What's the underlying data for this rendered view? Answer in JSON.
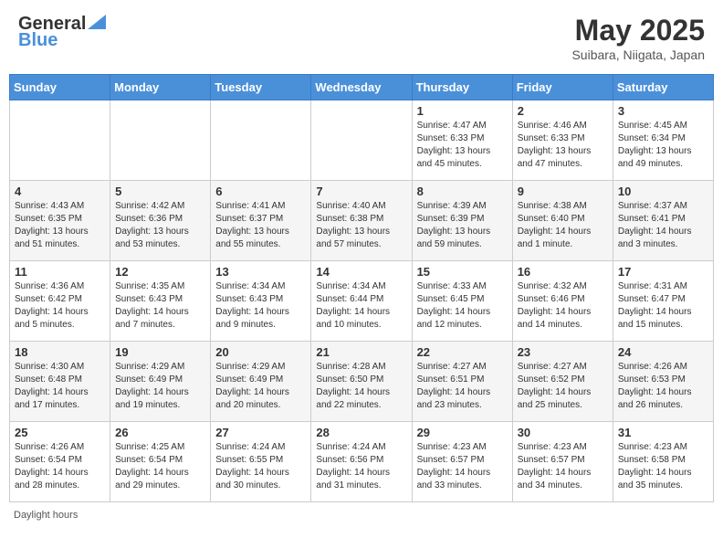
{
  "header": {
    "logo_line1": "General",
    "logo_line2": "Blue",
    "title": "May 2025",
    "subtitle": "Suibara, Niigata, Japan"
  },
  "days_of_week": [
    "Sunday",
    "Monday",
    "Tuesday",
    "Wednesday",
    "Thursday",
    "Friday",
    "Saturday"
  ],
  "footer": "Daylight hours",
  "weeks": [
    [
      {
        "day": "",
        "info": ""
      },
      {
        "day": "",
        "info": ""
      },
      {
        "day": "",
        "info": ""
      },
      {
        "day": "",
        "info": ""
      },
      {
        "day": "1",
        "info": "Sunrise: 4:47 AM\nSunset: 6:33 PM\nDaylight: 13 hours\nand 45 minutes."
      },
      {
        "day": "2",
        "info": "Sunrise: 4:46 AM\nSunset: 6:33 PM\nDaylight: 13 hours\nand 47 minutes."
      },
      {
        "day": "3",
        "info": "Sunrise: 4:45 AM\nSunset: 6:34 PM\nDaylight: 13 hours\nand 49 minutes."
      }
    ],
    [
      {
        "day": "4",
        "info": "Sunrise: 4:43 AM\nSunset: 6:35 PM\nDaylight: 13 hours\nand 51 minutes."
      },
      {
        "day": "5",
        "info": "Sunrise: 4:42 AM\nSunset: 6:36 PM\nDaylight: 13 hours\nand 53 minutes."
      },
      {
        "day": "6",
        "info": "Sunrise: 4:41 AM\nSunset: 6:37 PM\nDaylight: 13 hours\nand 55 minutes."
      },
      {
        "day": "7",
        "info": "Sunrise: 4:40 AM\nSunset: 6:38 PM\nDaylight: 13 hours\nand 57 minutes."
      },
      {
        "day": "8",
        "info": "Sunrise: 4:39 AM\nSunset: 6:39 PM\nDaylight: 13 hours\nand 59 minutes."
      },
      {
        "day": "9",
        "info": "Sunrise: 4:38 AM\nSunset: 6:40 PM\nDaylight: 14 hours\nand 1 minute."
      },
      {
        "day": "10",
        "info": "Sunrise: 4:37 AM\nSunset: 6:41 PM\nDaylight: 14 hours\nand 3 minutes."
      }
    ],
    [
      {
        "day": "11",
        "info": "Sunrise: 4:36 AM\nSunset: 6:42 PM\nDaylight: 14 hours\nand 5 minutes."
      },
      {
        "day": "12",
        "info": "Sunrise: 4:35 AM\nSunset: 6:43 PM\nDaylight: 14 hours\nand 7 minutes."
      },
      {
        "day": "13",
        "info": "Sunrise: 4:34 AM\nSunset: 6:43 PM\nDaylight: 14 hours\nand 9 minutes."
      },
      {
        "day": "14",
        "info": "Sunrise: 4:34 AM\nSunset: 6:44 PM\nDaylight: 14 hours\nand 10 minutes."
      },
      {
        "day": "15",
        "info": "Sunrise: 4:33 AM\nSunset: 6:45 PM\nDaylight: 14 hours\nand 12 minutes."
      },
      {
        "day": "16",
        "info": "Sunrise: 4:32 AM\nSunset: 6:46 PM\nDaylight: 14 hours\nand 14 minutes."
      },
      {
        "day": "17",
        "info": "Sunrise: 4:31 AM\nSunset: 6:47 PM\nDaylight: 14 hours\nand 15 minutes."
      }
    ],
    [
      {
        "day": "18",
        "info": "Sunrise: 4:30 AM\nSunset: 6:48 PM\nDaylight: 14 hours\nand 17 minutes."
      },
      {
        "day": "19",
        "info": "Sunrise: 4:29 AM\nSunset: 6:49 PM\nDaylight: 14 hours\nand 19 minutes."
      },
      {
        "day": "20",
        "info": "Sunrise: 4:29 AM\nSunset: 6:49 PM\nDaylight: 14 hours\nand 20 minutes."
      },
      {
        "day": "21",
        "info": "Sunrise: 4:28 AM\nSunset: 6:50 PM\nDaylight: 14 hours\nand 22 minutes."
      },
      {
        "day": "22",
        "info": "Sunrise: 4:27 AM\nSunset: 6:51 PM\nDaylight: 14 hours\nand 23 minutes."
      },
      {
        "day": "23",
        "info": "Sunrise: 4:27 AM\nSunset: 6:52 PM\nDaylight: 14 hours\nand 25 minutes."
      },
      {
        "day": "24",
        "info": "Sunrise: 4:26 AM\nSunset: 6:53 PM\nDaylight: 14 hours\nand 26 minutes."
      }
    ],
    [
      {
        "day": "25",
        "info": "Sunrise: 4:26 AM\nSunset: 6:54 PM\nDaylight: 14 hours\nand 28 minutes."
      },
      {
        "day": "26",
        "info": "Sunrise: 4:25 AM\nSunset: 6:54 PM\nDaylight: 14 hours\nand 29 minutes."
      },
      {
        "day": "27",
        "info": "Sunrise: 4:24 AM\nSunset: 6:55 PM\nDaylight: 14 hours\nand 30 minutes."
      },
      {
        "day": "28",
        "info": "Sunrise: 4:24 AM\nSunset: 6:56 PM\nDaylight: 14 hours\nand 31 minutes."
      },
      {
        "day": "29",
        "info": "Sunrise: 4:23 AM\nSunset: 6:57 PM\nDaylight: 14 hours\nand 33 minutes."
      },
      {
        "day": "30",
        "info": "Sunrise: 4:23 AM\nSunset: 6:57 PM\nDaylight: 14 hours\nand 34 minutes."
      },
      {
        "day": "31",
        "info": "Sunrise: 4:23 AM\nSunset: 6:58 PM\nDaylight: 14 hours\nand 35 minutes."
      }
    ]
  ]
}
